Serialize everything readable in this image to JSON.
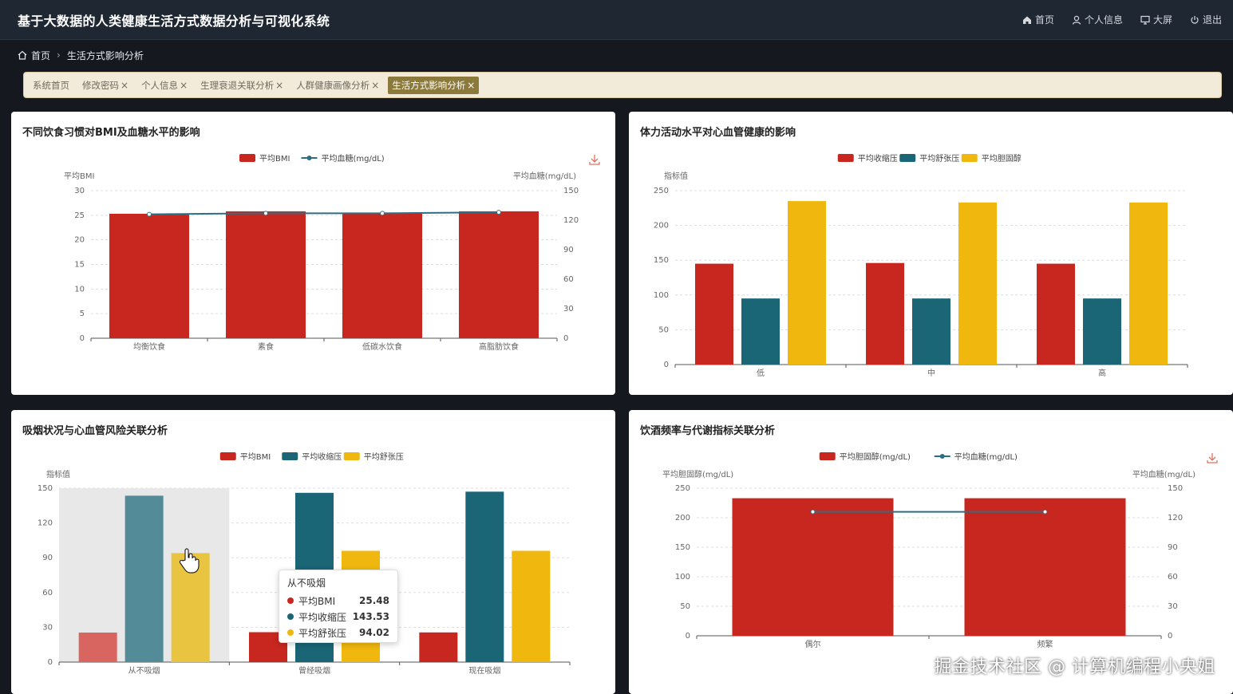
{
  "header": {
    "title": "基于大数据的人类健康生活方式数据分析与可视化系统",
    "nav": [
      {
        "label": "首页",
        "icon": "home-icon"
      },
      {
        "label": "个人信息",
        "icon": "user-icon"
      },
      {
        "label": "大屏",
        "icon": "monitor-icon"
      },
      {
        "label": "退出",
        "icon": "power-icon"
      }
    ]
  },
  "breadcrumb": {
    "home": "首页",
    "current": "生活方式影响分析"
  },
  "tabs": [
    {
      "label": "系统首页",
      "closable": false,
      "active": false
    },
    {
      "label": "修改密码",
      "closable": true,
      "active": false
    },
    {
      "label": "个人信息",
      "closable": true,
      "active": false
    },
    {
      "label": "生理衰退关联分析",
      "closable": true,
      "active": false
    },
    {
      "label": "人群健康画像分析",
      "closable": true,
      "active": false
    },
    {
      "label": "生活方式影响分析",
      "closable": true,
      "active": true
    }
  ],
  "colors": {
    "red": "#c8271f",
    "teal": "#1a6576",
    "yellow": "#f0b80e",
    "line": "#2e6e82"
  },
  "watermark": "掘金技术社区 @ 计算机编程小央姐",
  "charts": [
    {
      "title": "不同饮食习惯对BMI及血糖水平的影响",
      "chart_data": {
        "type": "bar",
        "categories": [
          "均衡饮食",
          "素食",
          "低碳水饮食",
          "高脂肪饮食"
        ],
        "series": [
          {
            "name": "平均BMI",
            "kind": "bar",
            "axis": "left",
            "values": [
              25.3,
              25.8,
              25.4,
              25.8
            ]
          },
          {
            "name": "平均血糖(mg/dL)",
            "kind": "line",
            "axis": "right",
            "values": [
              126,
              127,
              127,
              128
            ]
          }
        ],
        "ylabel": "平均BMI",
        "ylim": [
          0,
          30
        ],
        "yticks": [
          0,
          5,
          10,
          15,
          20,
          25,
          30
        ],
        "y2label": "平均血糖(mg/dL)",
        "y2lim": [
          0,
          150
        ],
        "y2ticks": [
          0,
          30,
          60,
          90,
          120,
          150
        ],
        "legend": "top-center"
      }
    },
    {
      "title": "体力活动水平对心血管健康的影响",
      "chart_data": {
        "type": "bar",
        "categories": [
          "低",
          "中",
          "高"
        ],
        "series": [
          {
            "name": "平均收缩压",
            "values": [
              145,
              146,
              145
            ]
          },
          {
            "name": "平均舒张压",
            "values": [
              95,
              95,
              95
            ]
          },
          {
            "name": "平均胆固醇",
            "values": [
              235,
              233,
              233
            ]
          }
        ],
        "ylabel": "指标值",
        "ylim": [
          0,
          250
        ],
        "yticks": [
          0,
          50,
          100,
          150,
          200,
          250
        ],
        "legend": "top-center"
      }
    },
    {
      "title": "吸烟状况与心血管风险关联分析",
      "chart_data": {
        "type": "bar",
        "categories": [
          "从不吸烟",
          "曾经吸烟",
          "现在吸烟"
        ],
        "series": [
          {
            "name": "平均BMI",
            "values": [
              25.48,
              25.8,
              25.6
            ]
          },
          {
            "name": "平均收缩压",
            "values": [
              143.53,
              146,
              147
            ]
          },
          {
            "name": "平均舒张压",
            "values": [
              94.02,
              96,
              96
            ]
          }
        ],
        "ylabel": "指标值",
        "ylim": [
          0,
          150
        ],
        "yticks": [
          0,
          30,
          60,
          90,
          120,
          150
        ],
        "legend": "top-center"
      },
      "tooltip": {
        "title": "从不吸烟",
        "rows": [
          {
            "name": "平均BMI",
            "value": "25.48"
          },
          {
            "name": "平均收缩压",
            "value": "143.53"
          },
          {
            "name": "平均舒张压",
            "value": "94.02"
          }
        ]
      }
    },
    {
      "title": "饮酒频率与代谢指标关联分析",
      "chart_data": {
        "type": "bar",
        "categories": [
          "偶尔",
          "频繁"
        ],
        "series": [
          {
            "name": "平均胆固醇(mg/dL)",
            "kind": "bar",
            "axis": "left",
            "values": [
              233,
              233
            ]
          },
          {
            "name": "平均血糖(mg/dL)",
            "kind": "line",
            "axis": "right",
            "values": [
              126,
              126
            ]
          }
        ],
        "ylabel": "平均胆固醇(mg/dL)",
        "ylim": [
          0,
          250
        ],
        "yticks": [
          0,
          50,
          100,
          150,
          200,
          250
        ],
        "y2label": "平均血糖(mg/dL)",
        "y2lim": [
          0,
          150
        ],
        "y2ticks": [
          0,
          30,
          60,
          90,
          120,
          150
        ],
        "legend": "top-center"
      }
    }
  ]
}
